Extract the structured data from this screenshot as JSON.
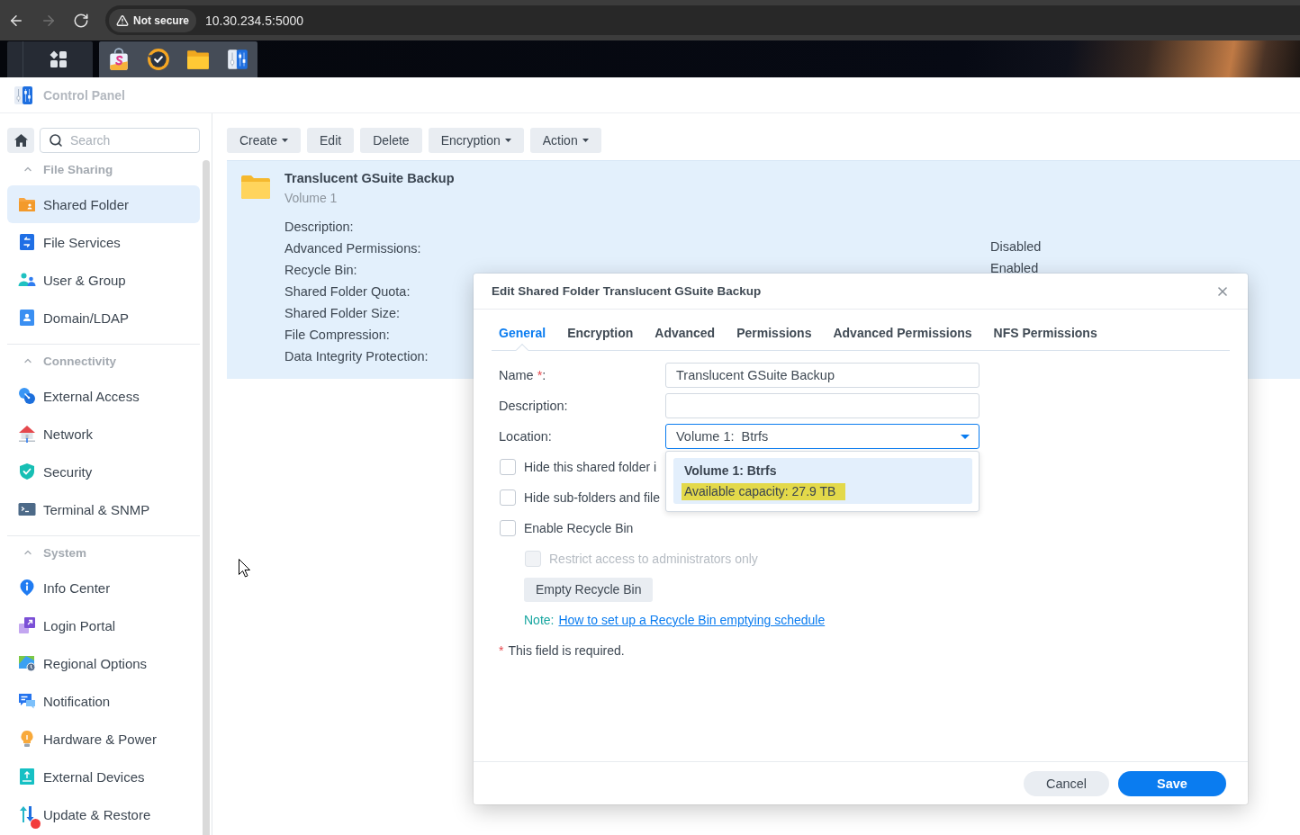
{
  "browser": {
    "buttons": [
      {
        "kind": "back",
        "disabled": false
      },
      {
        "kind": "forward",
        "disabled": true
      },
      {
        "kind": "reload",
        "disabled": false
      }
    ],
    "security_label": "Not secure",
    "url": "10.30.234.5:5000"
  },
  "window": {
    "title": "Control Panel"
  },
  "sidebar": {
    "search": {
      "placeholder": "Search"
    },
    "groups": [
      {
        "title": "File Sharing",
        "expanded": true,
        "items": [
          {
            "label": "Shared Folder",
            "selected": true,
            "alert": false
          },
          {
            "label": "File Services",
            "selected": false,
            "alert": false
          },
          {
            "label": "User & Group",
            "selected": false,
            "alert": false
          },
          {
            "label": "Domain/LDAP",
            "selected": false,
            "alert": false
          }
        ]
      },
      {
        "title": "Connectivity",
        "expanded": true,
        "items": [
          {
            "label": "External Access",
            "selected": false,
            "alert": false
          },
          {
            "label": "Network",
            "selected": false,
            "alert": false
          },
          {
            "label": "Security",
            "selected": false,
            "alert": false
          },
          {
            "label": "Terminal & SNMP",
            "selected": false,
            "alert": false
          }
        ]
      },
      {
        "title": "System",
        "expanded": true,
        "items": [
          {
            "label": "Info Center",
            "selected": false,
            "alert": false
          },
          {
            "label": "Login Portal",
            "selected": false,
            "alert": false
          },
          {
            "label": "Regional Options",
            "selected": false,
            "alert": false
          },
          {
            "label": "Notification",
            "selected": false,
            "alert": false
          },
          {
            "label": "Hardware & Power",
            "selected": false,
            "alert": false
          },
          {
            "label": "External Devices",
            "selected": false,
            "alert": false
          },
          {
            "label": "Update & Restore",
            "selected": false,
            "alert": true
          }
        ]
      }
    ]
  },
  "toolbar": {
    "buttons": [
      {
        "label": "Create",
        "menu": true
      },
      {
        "label": "Edit",
        "menu": false
      },
      {
        "label": "Delete",
        "menu": false
      },
      {
        "label": "Encryption",
        "menu": true
      },
      {
        "label": "Action",
        "menu": true
      }
    ]
  },
  "shared_folders": [
    {
      "name": "Translucent GSuite Backup",
      "volume": "Volume 1",
      "selected": true,
      "details": [
        {
          "label": "Description:"
        },
        {
          "label": "Advanced Permissions:",
          "value": "Disabled"
        },
        {
          "label": "Recycle Bin:",
          "value": "Enabled"
        },
        {
          "label": "Shared Folder Quota:"
        },
        {
          "label": "Shared Folder Size:"
        },
        {
          "label": "File Compression:"
        },
        {
          "label": "Data Integrity Protection:"
        }
      ]
    }
  ],
  "dialog": {
    "title": "Edit Shared Folder Translucent GSuite Backup",
    "tabs": [
      {
        "label": "General",
        "selected": true
      },
      {
        "label": "Encryption",
        "selected": false
      },
      {
        "label": "Advanced",
        "selected": false
      },
      {
        "label": "Permissions",
        "selected": false
      },
      {
        "label": "Advanced Permissions",
        "selected": false
      },
      {
        "label": "NFS Permissions",
        "selected": false
      }
    ],
    "fields": [
      {
        "kind": "text",
        "label": "Name",
        "required_mark": "*",
        "label_suffix": ":",
        "value": "Translucent GSuite Backup"
      },
      {
        "kind": "text",
        "label": "Description:"
      },
      {
        "kind": "select",
        "label": "Location:",
        "value": "Volume 1:  Btrfs",
        "open": true,
        "options": [
          {
            "title": "Volume 1: Btrfs",
            "detail": "Available capacity: 27.9 TB",
            "selected": true,
            "highlighted": true
          }
        ]
      }
    ],
    "options": [
      {
        "kind": "checkbox",
        "label": "Hide this shared folder i",
        "checked": false,
        "disabled": false
      },
      {
        "kind": "checkbox",
        "label": "Hide sub-folders and file",
        "checked": false,
        "disabled": false
      },
      {
        "kind": "checkbox",
        "label": "Enable Recycle Bin",
        "checked": false,
        "disabled": false,
        "children": [
          {
            "kind": "checkbox",
            "label": "Restrict access to administrators only",
            "checked": false,
            "disabled": true
          },
          {
            "kind": "button",
            "label": "Empty Recycle Bin"
          },
          {
            "kind": "note",
            "label": "Note:",
            "link": "How to set up a Recycle Bin emptying schedule"
          }
        ]
      }
    ],
    "required_note": {
      "mark": "*",
      "text": "This field is required."
    },
    "buttons": [
      {
        "label": "Cancel",
        "kind": "secondary"
      },
      {
        "label": "Save",
        "kind": "primary"
      }
    ]
  }
}
